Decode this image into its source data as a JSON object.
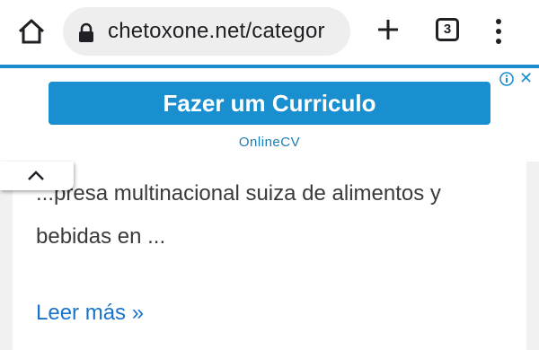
{
  "browser": {
    "url": "chetoxone.net/categor",
    "tab_count": "3",
    "icons": [
      "home-icon",
      "lock-icon",
      "plus-icon",
      "tab-switcher-icon",
      "more-vert-icon"
    ]
  },
  "ad": {
    "button_label": "Fazer um Curriculo",
    "sponsor": "OnlineCV",
    "info_icon": "info-icon",
    "close_label": "✕",
    "accent_color": "#1a8fd0"
  },
  "article": {
    "excerpt": "...presa multinacional suiza de alimentos y bebidas en ...",
    "read_more": "Leer más »",
    "link_color": "#1a73c9"
  }
}
